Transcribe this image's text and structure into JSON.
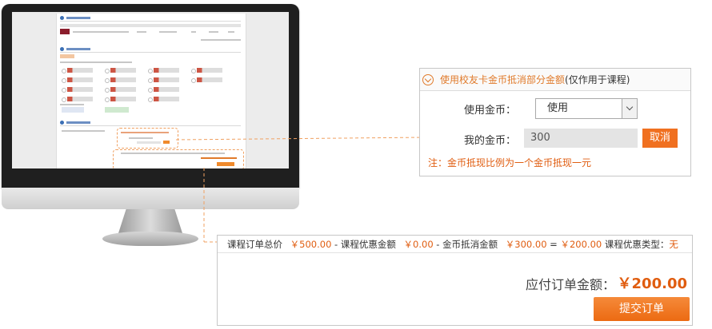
{
  "coin_panel": {
    "title": "使用校友卡金币抵消部分金额",
    "title_paren": "(仅作用于课程)",
    "use_label": "使用金币：",
    "use_selected": "使用",
    "mycoins_label": "我的金币：",
    "mycoins_value": "300",
    "cancel_label": "取消",
    "note": "注：金币抵现比例为一个金币抵现一元"
  },
  "order_panel": {
    "total_label": "课程订单总价",
    "total_amount": "￥500.00",
    "sep_minus_1": " - ",
    "discount_label": "课程优惠金额",
    "discount_amount": "￥0.00",
    "sep_minus_2": " - ",
    "coin_label": "金币抵消金额",
    "coin_amount": "￥300.00",
    "sep_equals": " = ",
    "result_amount": "￥200.00",
    "type_label": "课程优惠类型：",
    "type_value": "无",
    "payable_label": "应付订单金额：",
    "payable_amount": "￥200.00",
    "submit_label": "提交订单"
  },
  "colors": {
    "accent": "#e07a2a",
    "button": "#f07020",
    "price": "#e05d10"
  }
}
